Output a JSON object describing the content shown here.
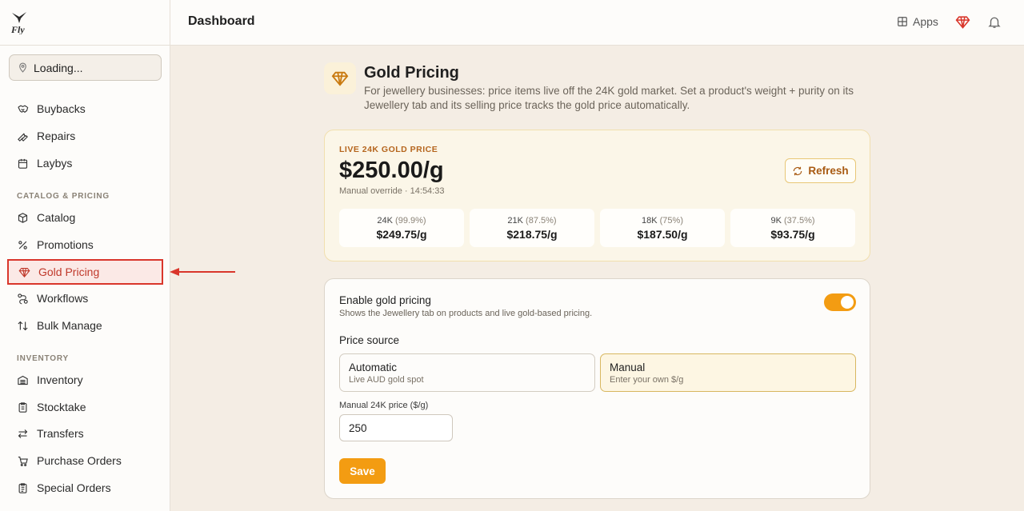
{
  "brand": {
    "logo_text": "Fly"
  },
  "topbar": {
    "title": "Dashboard",
    "apps_label": "Apps"
  },
  "location": {
    "label": "Loading..."
  },
  "sidebar": {
    "top_items": [
      {
        "label": "Buybacks",
        "icon": "handshake-icon"
      },
      {
        "label": "Repairs",
        "icon": "wrench-icon"
      },
      {
        "label": "Laybys",
        "icon": "calendar-icon"
      }
    ],
    "sections": [
      {
        "label": "CATALOG & PRICING",
        "items": [
          {
            "label": "Catalog",
            "icon": "box-icon"
          },
          {
            "label": "Promotions",
            "icon": "percent-icon"
          },
          {
            "label": "Gold Pricing",
            "icon": "gem-icon",
            "active": true
          },
          {
            "label": "Workflows",
            "icon": "workflow-icon"
          },
          {
            "label": "Bulk Manage",
            "icon": "sort-arrows-icon"
          }
        ]
      },
      {
        "label": "INVENTORY",
        "items": [
          {
            "label": "Inventory",
            "icon": "warehouse-icon"
          },
          {
            "label": "Stocktake",
            "icon": "clipboard-icon"
          },
          {
            "label": "Transfers",
            "icon": "transfer-arrows-icon"
          },
          {
            "label": "Purchase Orders",
            "icon": "cart-icon"
          },
          {
            "label": "Special Orders",
            "icon": "clipboard-list-icon"
          }
        ]
      }
    ]
  },
  "page": {
    "title": "Gold Pricing",
    "description": "For jewellery businesses: price items live off the 24K gold market. Set a product's weight + purity on its Jewellery tab and its selling price tracks the gold price automatically."
  },
  "price_card": {
    "label": "LIVE 24K GOLD PRICE",
    "price": "$250.00/g",
    "subtitle": "Manual override · 14:54:33",
    "refresh_label": "Refresh",
    "karats": [
      {
        "name": "24K",
        "purity": "(99.9%)",
        "value": "$249.75/g"
      },
      {
        "name": "21K",
        "purity": "(87.5%)",
        "value": "$218.75/g"
      },
      {
        "name": "18K",
        "purity": "(75%)",
        "value": "$187.50/g"
      },
      {
        "name": "9K",
        "purity": "(37.5%)",
        "value": "$93.75/g"
      }
    ]
  },
  "settings": {
    "enable_title": "Enable gold pricing",
    "enable_desc": "Shows the Jewellery tab on products and live gold-based pricing.",
    "enabled": true,
    "price_source_label": "Price source",
    "options": [
      {
        "title": "Automatic",
        "desc": "Live AUD gold spot",
        "selected": false
      },
      {
        "title": "Manual",
        "desc": "Enter your own $/g",
        "selected": true
      }
    ],
    "manual_label": "Manual 24K price ($/g)",
    "manual_value": "250",
    "save_label": "Save"
  },
  "colors": {
    "accent": "#f39c12",
    "active_nav": "#c0392b",
    "highlight_border": "#d9362b",
    "gold_label": "#b5651d"
  }
}
